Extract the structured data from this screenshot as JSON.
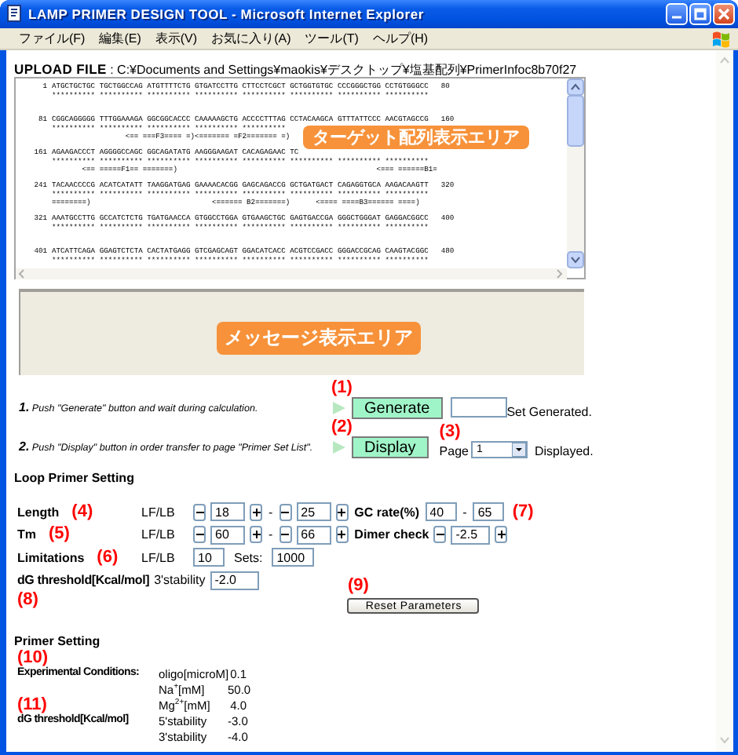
{
  "window": {
    "title": "LAMP PRIMER DESIGN TOOL - Microsoft Internet Explorer"
  },
  "menu": [
    "ファイル(F)",
    "編集(E)",
    "表示(V)",
    "お気に入り(A)",
    "ツール(T)",
    "ヘルプ(H)"
  ],
  "upload": {
    "label": "UPLOAD FILE",
    "path": ": C:¥Documents and Settings¥maokis¥デスクトップ¥塩基配列¥PrimerInfoc8b70f27"
  },
  "sequence": {
    "overlay_label": "ターゲット配列表示エリア",
    "blocks": [
      {
        "num": "1",
        "bases": "ATGCTGCTGC TGCTGGCCAG ATGTTTTCTG GTGATCCTTG CTTCCTCGCT GCTGGTGTGC CCCGGGCTGG CCTGTGGGCC",
        "end": "80",
        "match": "********** ********** ********** ********** ********** ********** ********** **********"
      },
      {
        "num": "81",
        "bases": "CGGCAGGGGG TTTGGAAAGA GGCGGCACCC CAAAAAGCTG ACCCCTTTAG CCTACAAGCA GTTTATTCCC AACGTAGCCG",
        "end": "160",
        "match": "********** ********** ********** ********** **********",
        "primers": "                 <== ===F3==== =)<======= =F2======= =)"
      },
      {
        "num": "161",
        "bases": "AGAAGACCCT AGGGGCCAGC GGCAGATATG AAGGGAAGAT CACAGAGAAC TC",
        "match": "********** ********** ********** ********** ********** ********** ********** **********",
        "primers": "       <== =====F1== =======)                                              <=== ======B1="
      },
      {
        "num": "241",
        "bases": "TACAACCCCG ACATCATATT TAAGGATGAG GAAAACACGG GAGCAGACCG GCTGATGACT CAGAGGTGCA AAGACAAGTT",
        "end": "320",
        "match": "********** ********** ********** ********** ********** ********** ********** **********",
        "primers": "========)                            <====== B2=======)      <==== ====B3====== ====)"
      },
      {
        "num": "321",
        "bases": "AAATGCCTTG GCCATCTCTG TGATGAACCA GTGGCCTGGA GTGAAGCTGC GAGTGACCGA GGGCTGGGAT GAGGACGGCC",
        "end": "400",
        "match": "********** ********** ********** ********** ********** ********** ********** **********"
      },
      {
        "num": "401",
        "bases": "ATCATTCAGA GGAGTCTCTA CACTATGAGG GTCGAGCAGT GGACATCACC ACGTCCGACC GGGACCGCAG CAAGTACGGC",
        "end": "480",
        "match": "********** ********** ********** ********** ********** ********** ********** **********"
      }
    ]
  },
  "message_area": {
    "overlay_label": "メッセージ表示エリア"
  },
  "steps": [
    {
      "text": "**1.** Push \"Generate\" button and wait during calculation.",
      "marker": "(1)",
      "button": "Generate"
    },
    {
      "text": "**2.** Push \"Display\" button in order transfer to page \"Primer Set List\".",
      "marker": "(2)",
      "button": "Display"
    }
  ],
  "generated": {
    "label": "Set Generated."
  },
  "page": {
    "marker": "(3)",
    "label": "Page",
    "value": "1",
    "suffix": "Displayed."
  },
  "loop_primer": {
    "title": "Loop Primer Setting",
    "rows": [
      {
        "kind": "range",
        "label": "Length",
        "marker": "(4)",
        "unit": "LF/LB",
        "from": "18",
        "to": "25",
        "separator": "-",
        "side": {
          "kind": "pair",
          "label": "GC rate(%)",
          "from": "40",
          "to": "65",
          "separator": "-",
          "marker": "(7)"
        }
      },
      {
        "kind": "range",
        "label": "Tm",
        "marker": "(5)",
        "unit": "LF/LB",
        "from": "60",
        "to": "66",
        "separator": "-",
        "side": {
          "kind": "spin",
          "label": "Dimer check",
          "value": "-2.5"
        }
      },
      {
        "kind": "limit",
        "label": "Limitations",
        "marker": "(6)",
        "unit": "LF/LB",
        "value": "10",
        "sets_label": "Sets:",
        "sets": "1000"
      },
      {
        "kind": "threshold",
        "label": "dG threshold[Kcal/mol]",
        "marker": "(8)",
        "unit": "3'stability",
        "value": "-2.0"
      }
    ],
    "reset": {
      "marker": "(9)",
      "label": "Reset Parameters"
    }
  },
  "primer": {
    "title": "Primer Setting",
    "groups": [
      {
        "marker": "(10)",
        "label": "Experimental Conditions:",
        "items": [
          {
            "name": "oligo[microM]",
            "value": "0.1"
          },
          {
            "name": "Na$^{+}$[mM]",
            "value": "50.0"
          },
          {
            "name": "Mg$^{2+}$[mM]",
            "value": "4.0"
          }
        ]
      },
      {
        "marker": "(11)",
        "label": "dG threshold[Kcal/mol]",
        "items": [
          {
            "name": "5'stability",
            "value": "-3.0"
          },
          {
            "name": "3'stability",
            "value": "-4.0"
          }
        ]
      }
    ]
  }
}
